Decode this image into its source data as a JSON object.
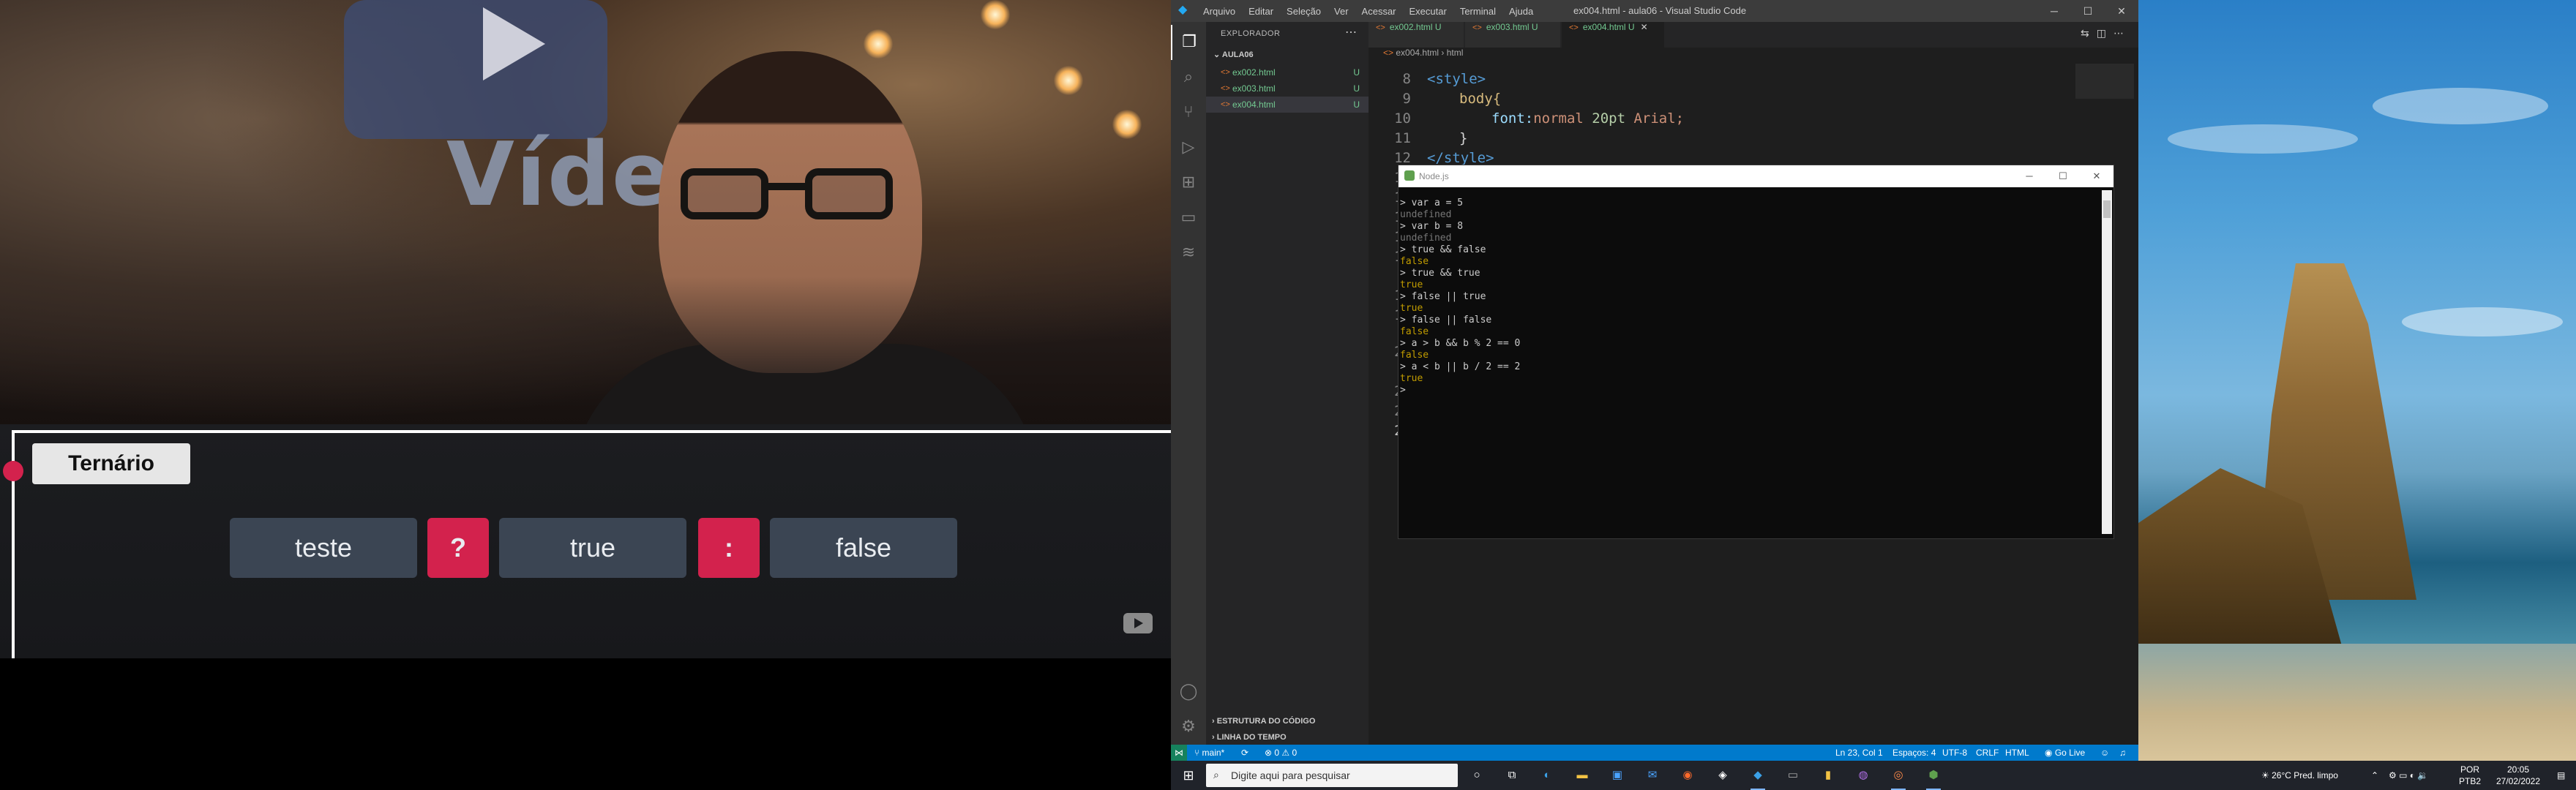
{
  "video": {
    "brand_word": "Vídeo",
    "topic": "Ternário",
    "chips": [
      "teste",
      "?",
      "true",
      ":",
      "false"
    ]
  },
  "vscode": {
    "titlebar": {
      "menu": [
        "Arquivo",
        "Editar",
        "Seleção",
        "Ver",
        "Acessar",
        "Executar",
        "Terminal",
        "Ajuda"
      ],
      "window_title": "ex004.html - aula06 - Visual Studio Code"
    },
    "explorer": {
      "header": "EXPLORADOR",
      "folder": "AULA06",
      "files": [
        {
          "name": "ex002.html",
          "status": "U"
        },
        {
          "name": "ex003.html",
          "status": "U"
        },
        {
          "name": "ex004.html",
          "status": "U"
        }
      ],
      "outline": "ESTRUTURA DO CÓDIGO",
      "timeline": "LINHA DO TEMPO"
    },
    "tabs": [
      {
        "label": "ex002.html",
        "status": "U"
      },
      {
        "label": "ex003.html",
        "status": "U"
      },
      {
        "label": "ex004.html",
        "status": "U"
      }
    ],
    "breadcrumb": [
      "ex004.html",
      "html"
    ],
    "line_numbers": [
      "8",
      "9",
      "10",
      "11",
      "12",
      "13",
      "14",
      "15",
      "16",
      "17",
      "18",
      "19",
      "20",
      "21",
      "22",
      "23"
    ],
    "code": {
      "l8": "<style>",
      "l9_sel": "body{",
      "l10_prop": "font:",
      "l10_val": "normal ",
      "l10_num": "20pt",
      "l10_val2": " Arial;",
      "l11": "}",
      "l12": "</style>"
    },
    "node": {
      "title": "Node.js",
      "console": [
        {
          "cls": "c-in",
          "text": "> var a = 5"
        },
        {
          "cls": "c-undef",
          "text": "undefined"
        },
        {
          "cls": "c-in",
          "text": "> var b = 8"
        },
        {
          "cls": "c-undef",
          "text": "undefined"
        },
        {
          "cls": "c-in",
          "text": "> true && false"
        },
        {
          "cls": "c-bool",
          "text": "false"
        },
        {
          "cls": "c-in",
          "text": "> true && true"
        },
        {
          "cls": "c-bool",
          "text": "true"
        },
        {
          "cls": "c-in",
          "text": "> false || true"
        },
        {
          "cls": "c-bool",
          "text": "true"
        },
        {
          "cls": "c-in",
          "text": "> false || false"
        },
        {
          "cls": "c-bool",
          "text": "false"
        },
        {
          "cls": "c-in",
          "text": "> a > b && b % 2 == 0"
        },
        {
          "cls": "c-bool",
          "text": "false"
        },
        {
          "cls": "c-in",
          "text": "> a < b || b / 2 == 2"
        },
        {
          "cls": "c-bool",
          "text": "true"
        },
        {
          "cls": "c-in",
          "text": ">"
        }
      ]
    },
    "status": {
      "branch": "main*",
      "errors": "⊗ 0 ⚠ 0",
      "position": "Ln 23, Col 1",
      "spaces": "Espaços: 4",
      "encoding": "UTF-8",
      "eol": "CRLF",
      "language": "HTML",
      "golive": "Go Live"
    }
  },
  "taskbar": {
    "search_placeholder": "Digite aqui para pesquisar",
    "weather": "26°C  Pred. limpo",
    "lang": "POR",
    "kbd": "PTB2",
    "time": "20:05",
    "date": "27/02/2022"
  },
  "colors": {
    "accent_red": "#d3224d",
    "chip_gray": "#3b4553",
    "vscode_blue": "#007acc",
    "git_untracked": "#73c991",
    "node_bool": "#c19c00"
  }
}
